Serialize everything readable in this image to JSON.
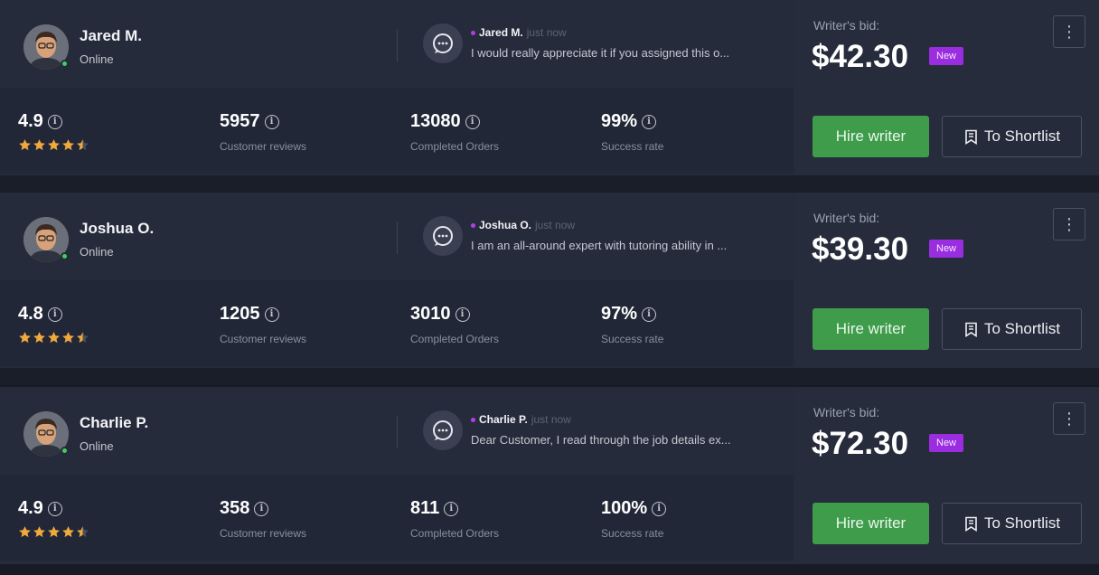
{
  "colors": {
    "background": "#171b25",
    "card": "#262b3b",
    "stats_band": "#222737",
    "accent_purple": "#9b2de0",
    "hire_green": "#3e9c4a",
    "online_green": "#3fcf5c",
    "star_gold": "#f0a93c"
  },
  "icons": {
    "chat": "chat-bubble-icon",
    "info": "info-icon",
    "star": "star-icon",
    "more": "more-vertical-icon",
    "shortlist": "bookmark-icon"
  },
  "bids": [
    {
      "writer": {
        "name": "Jared M.",
        "status": "Online"
      },
      "message": {
        "sender": "Jared M.",
        "time": "just now",
        "text": "I would really appreciate it if you assigned this o..."
      },
      "stats": {
        "rating": "4.9",
        "stars": 4.5,
        "reviews": "5957",
        "reviews_label": "Customer reviews",
        "orders": "13080",
        "orders_label": "Completed Orders",
        "success": "99%",
        "success_label": "Success rate"
      },
      "bid": {
        "label": "Writer's bid:",
        "amount": "$42.30",
        "badge": "New"
      },
      "actions": {
        "hire": "Hire writer",
        "shortlist": "To Shortlist",
        "more": "⋮"
      }
    },
    {
      "writer": {
        "name": "Joshua O.",
        "status": "Online"
      },
      "message": {
        "sender": "Joshua O.",
        "time": "just now",
        "text": "I am an all-around expert with tutoring ability in ..."
      },
      "stats": {
        "rating": "4.8",
        "stars": 4.5,
        "reviews": "1205",
        "reviews_label": "Customer reviews",
        "orders": "3010",
        "orders_label": "Completed Orders",
        "success": "97%",
        "success_label": "Success rate"
      },
      "bid": {
        "label": "Writer's bid:",
        "amount": "$39.30",
        "badge": "New"
      },
      "actions": {
        "hire": "Hire writer",
        "shortlist": "To Shortlist",
        "more": "⋮"
      }
    },
    {
      "writer": {
        "name": "Charlie P.",
        "status": "Online"
      },
      "message": {
        "sender": "Charlie P.",
        "time": "just now",
        "text": "Dear Customer, I read through the job details ex..."
      },
      "stats": {
        "rating": "4.9",
        "stars": 4.5,
        "reviews": "358",
        "reviews_label": "Customer reviews",
        "orders": "811",
        "orders_label": "Completed Orders",
        "success": "100%",
        "success_label": "Success rate"
      },
      "bid": {
        "label": "Writer's bid:",
        "amount": "$72.30",
        "badge": "New"
      },
      "actions": {
        "hire": "Hire writer",
        "shortlist": "To Shortlist",
        "more": "⋮"
      }
    }
  ]
}
